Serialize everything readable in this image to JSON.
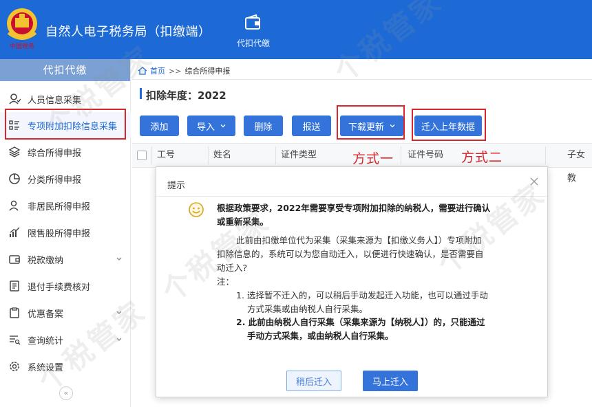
{
  "header": {
    "app_title": "自然人电子税务局（扣缴端）",
    "nav_item_label": "代扣代缴",
    "logo_text": "中国税务"
  },
  "sidebar": {
    "title": "代扣代缴",
    "items": [
      {
        "label": "人员信息采集",
        "icon": "person-icon"
      },
      {
        "label": "专项附加扣除信息采集",
        "icon": "list-icon"
      },
      {
        "label": "综合所得申报",
        "icon": "layers-icon"
      },
      {
        "label": "分类所得申报",
        "icon": "pie-icon"
      },
      {
        "label": "非居民所得申报",
        "icon": "person-outline-icon"
      },
      {
        "label": "限售股所得申报",
        "icon": "bar-chart-icon"
      },
      {
        "label": "税款缴纳",
        "icon": "wallet-icon"
      },
      {
        "label": "退付手续费核对",
        "icon": "document-icon"
      },
      {
        "label": "优惠备案",
        "icon": "folder-icon"
      },
      {
        "label": "查询统计",
        "icon": "query-list-icon"
      },
      {
        "label": "系统设置",
        "icon": "gear-icon"
      }
    ],
    "collapse_glyph": "«"
  },
  "breadcrumb": {
    "home": "首页",
    "separator": ">>",
    "current": "综合所得申报"
  },
  "year_label": "扣除年度：2022",
  "toolbar": {
    "add": "添加",
    "import": "导入",
    "delete": "删除",
    "submit": "报送",
    "download_update": "下载更新",
    "migrate_last_year": "迁入上年数据"
  },
  "table": {
    "columns": [
      "工号",
      "姓名",
      "证件类型",
      "证件号码",
      "子女教"
    ]
  },
  "annotations": {
    "method_one": "方式一",
    "method_two": "方式二"
  },
  "dialog": {
    "title": "提示",
    "line1": "根据政策要求，2022年需要享受专项附加扣除的纳税人，需要进行确认",
    "line2": "或重新采集。",
    "para1": "此前由扣缴单位代为采集（采集来源为【扣缴义务人】）专项附加",
    "para2": "扣除信息的，系统可以为您自动迁入，以便进行快速确认，是否需要自",
    "para3": "动迁入?",
    "note_label": "注：",
    "note1_a": "1. 选择暂不迁入的，可以稍后手动发起迁入功能，也可以通过手动",
    "note1_b": "方式采集或由纳税人自行采集。",
    "note2_a": "2. 此前由纳税人自行采集（采集来源为【纳税人】）的，只能通过",
    "note2_b": "手动方式采集，或由纳税人自行采集。",
    "btn_later": "稍后迁入",
    "btn_now": "马上迁入"
  },
  "watermark": "个税管家",
  "colors": {
    "header_blue": "#1d6ad6",
    "button_blue": "#3473d9",
    "annotation_red": "#d8262c",
    "sidebar_title_bg": "#7aa0d4"
  }
}
